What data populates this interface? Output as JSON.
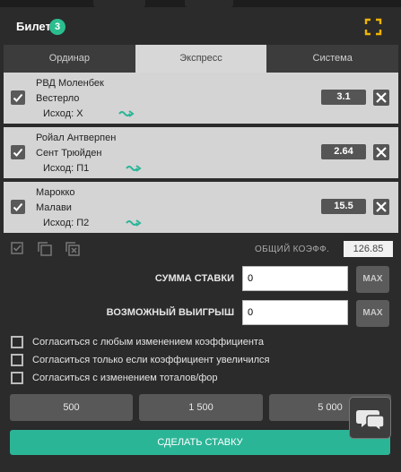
{
  "header": {
    "title": "Билет",
    "badge_count": "3"
  },
  "tabs": [
    {
      "label": "Ординар",
      "active": false
    },
    {
      "label": "Экспресс",
      "active": true
    },
    {
      "label": "Система",
      "active": false
    }
  ],
  "bets": [
    {
      "team1": "РВД Моленбек",
      "team2": "Вестерло",
      "outcome": "Исход: Х",
      "odd": "3.1"
    },
    {
      "team1": "Ройал Антверпен",
      "team2": "Сент Трюйден",
      "outcome": "Исход: П1",
      "odd": "2.64"
    },
    {
      "team1": "Марокко",
      "team2": "Малави",
      "outcome": "Исход: П2",
      "odd": "15.5"
    }
  ],
  "total": {
    "label": "ОБЩИЙ КОЭФФ.",
    "value": "126.85"
  },
  "stake": {
    "label": "СУММА СТАВКИ",
    "value": "0",
    "max_label": "MAX"
  },
  "win": {
    "label": "ВОЗМОЖНЫЙ ВЫИГРЫШ",
    "value": "0",
    "max_label": "MAX"
  },
  "options": [
    {
      "label": "Согласиться с любым изменением коэффициента",
      "checked": false
    },
    {
      "label": "Согласиться только если коэффициент увеличился",
      "checked": false
    },
    {
      "label": "Согласиться с изменением тоталов/фор",
      "checked": false
    }
  ],
  "quick_amounts": [
    "500",
    "1 500",
    "5 000"
  ],
  "submit_label": "СДЕЛАТЬ СТАВКУ",
  "colors": {
    "accent": "#2bb597",
    "badge": "#2bbd8f",
    "expand_icon": "#f0b400"
  },
  "icons": {
    "expand": "expand-icon",
    "check": "check-icon",
    "delete": "close-icon",
    "live": "live-stream-icon",
    "chat": "chat-icon"
  }
}
